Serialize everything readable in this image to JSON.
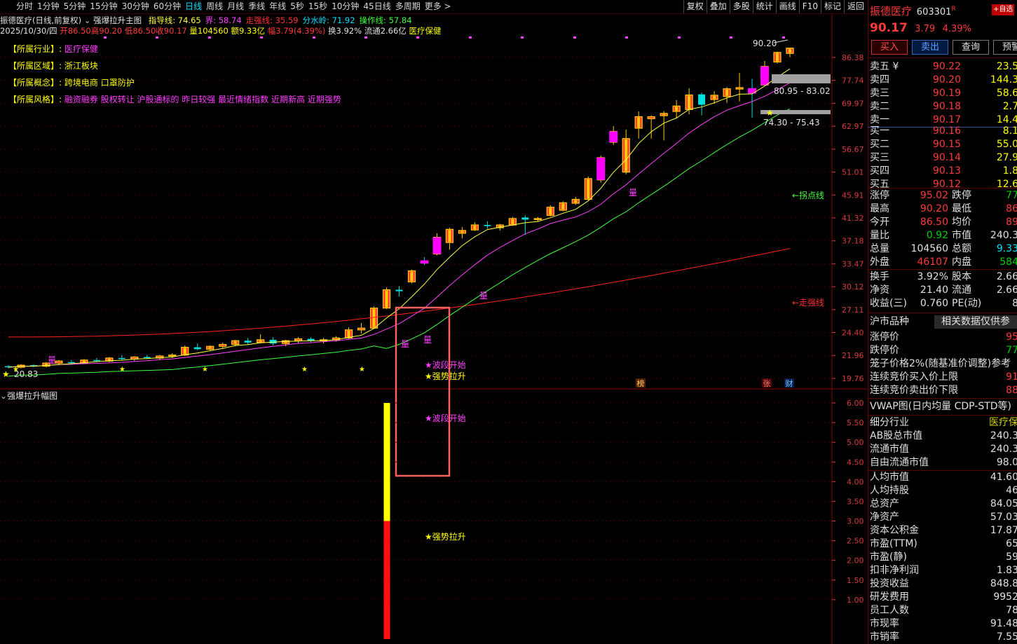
{
  "toolbar": {
    "periods": [
      "分时",
      "1分钟",
      "5分钟",
      "15分钟",
      "30分钟",
      "60分钟",
      "日线",
      "周线",
      "月线",
      "季线",
      "年线",
      "5秒",
      "15秒",
      "10分钟",
      "45日线",
      "多周期",
      "更多 >"
    ],
    "active_period": "日线",
    "right_buttons": [
      "复权",
      "叠加",
      "多股",
      "统计",
      "画线",
      "F10",
      "标记",
      "返回"
    ]
  },
  "indicator_line": {
    "stock": "振德医疗(日线,前复权)",
    "indicator_name": "强爆拉升主图",
    "items": [
      {
        "label": "指导线: 74.65",
        "color": "#ffff40"
      },
      {
        "label": "界: 58.74",
        "color": "#ff40ff"
      },
      {
        "label": "走强线: 35.59",
        "color": "#ff3030"
      },
      {
        "label": "分水岭: 71.92",
        "color": "#00e0ff"
      },
      {
        "label": "操作线: 57.84",
        "color": "#40ff40"
      }
    ]
  },
  "quote_line": {
    "date": "2025/10/30/四",
    "open": "开86.50",
    "high": "高90.20",
    "low": "低86.50",
    "close": "收90.17",
    "volume": "量104560",
    "amount": "额9.33亿",
    "range": "幅3.79(4.39%)",
    "turnover": "换3.92%",
    "float_cap": "流通2.66亿",
    "industry": "医疗保健"
  },
  "sector_info": [
    {
      "key": "【所属行业】:",
      "value": "医疗保健",
      "color": "#ff3cff"
    },
    {
      "key": "【所属区域】:",
      "value": "浙江板块",
      "color": "#ffff00"
    },
    {
      "key": "【所属概念】:",
      "value": "跨境电商 口罩防护",
      "color": "#ffff00"
    },
    {
      "key": "【所属风格】:",
      "value": "融资融券 股权转让 沪股通标的 昨日较强 最近情绪指数 近期新高 近期强势",
      "color": "#ff3cff"
    }
  ],
  "price_axis": [
    "86.38",
    "77.74",
    "69.97",
    "62.97",
    "56.67",
    "51.01",
    "45.91",
    "41.32",
    "37.18",
    "33.47",
    "30.12",
    "27.11",
    "24.40",
    "21.96",
    "19.76"
  ],
  "sub_axis": [
    "6.00",
    "5.50",
    "5.00",
    "4.50",
    "4.00",
    "3.50",
    "3.00",
    "2.50",
    "2.00",
    "1.50",
    "1.00"
  ],
  "sub_title": "强爆拉升幅图",
  "chart_labels": {
    "high_marker": "90.20",
    "zone_upper": "80.95 - 83.02",
    "zone_lower": "74.30 - 75.43",
    "low_marker": "20.83",
    "turn_line": "←拐点线",
    "strong_line": "←走强线",
    "wave_start": "★波段开始",
    "strong_pull": "★强势拉升",
    "vol_mark": "量",
    "bang_tag": "榜",
    "zhang_tag": "张",
    "cai_tag": "财",
    "sub_wave_start": "★波段开始",
    "sub_strong_pull": "★强势拉升"
  },
  "sub_bar": {
    "yellow_top": 6.0,
    "yellow_bottom": 3.0,
    "red_bottom": 0.0
  },
  "chart_data": {
    "type": "candlestick",
    "ohlc": [
      [
        20.9,
        21.0,
        20.7,
        20.8
      ],
      [
        20.8,
        21.1,
        20.7,
        21.0
      ],
      [
        21.0,
        21.1,
        20.8,
        20.9
      ],
      [
        20.9,
        21.3,
        20.8,
        21.2
      ],
      [
        21.2,
        21.5,
        21.0,
        21.4
      ],
      [
        21.3,
        21.5,
        21.1,
        21.2
      ],
      [
        21.2,
        21.6,
        21.1,
        21.5
      ],
      [
        21.5,
        21.7,
        21.3,
        21.4
      ],
      [
        21.4,
        21.8,
        21.3,
        21.7
      ],
      [
        21.7,
        22.0,
        21.5,
        21.6
      ],
      [
        21.6,
        21.9,
        21.4,
        21.8
      ],
      [
        21.8,
        22.0,
        21.6,
        21.7
      ],
      [
        21.7,
        22.0,
        21.5,
        21.9
      ],
      [
        21.9,
        22.2,
        21.7,
        22.0
      ],
      [
        22.0,
        23.0,
        21.9,
        22.8
      ],
      [
        22.8,
        23.2,
        22.5,
        22.6
      ],
      [
        22.6,
        23.0,
        22.4,
        22.9
      ],
      [
        22.9,
        23.3,
        22.7,
        23.1
      ],
      [
        23.1,
        23.6,
        22.9,
        23.5
      ],
      [
        23.5,
        23.8,
        23.1,
        23.3
      ],
      [
        23.3,
        24.2,
        23.2,
        23.6
      ],
      [
        23.6,
        23.9,
        23.0,
        23.2
      ],
      [
        23.2,
        23.6,
        22.9,
        23.5
      ],
      [
        23.5,
        23.9,
        23.2,
        23.7
      ],
      [
        23.7,
        23.9,
        23.3,
        23.5
      ],
      [
        23.5,
        23.8,
        23.2,
        23.6
      ],
      [
        23.6,
        24.0,
        23.4,
        23.8
      ],
      [
        23.8,
        25.0,
        23.7,
        24.7
      ],
      [
        24.7,
        25.5,
        24.3,
        24.9
      ],
      [
        24.9,
        27.5,
        24.8,
        27.3
      ],
      [
        27.3,
        30.0,
        27.2,
        29.7
      ],
      [
        29.7,
        30.2,
        28.8,
        29.5
      ],
      [
        30.8,
        32.6,
        30.6,
        32.4
      ],
      [
        34.0,
        34.5,
        33.3,
        33.5
      ],
      [
        35.0,
        38.5,
        34.8,
        37.8
      ],
      [
        36.9,
        39.5,
        35.7,
        39.2
      ],
      [
        38.5,
        39.6,
        37.6,
        39.0
      ],
      [
        39.1,
        40.5,
        38.9,
        40.0
      ],
      [
        40.0,
        40.7,
        39.3,
        39.8
      ],
      [
        39.5,
        40.2,
        39.0,
        40.0
      ],
      [
        40.0,
        41.5,
        39.8,
        41.2
      ],
      [
        41.4,
        41.8,
        38.2,
        41.0
      ],
      [
        41.1,
        41.5,
        40.6,
        41.2
      ],
      [
        41.8,
        43.8,
        41.6,
        43.4
      ],
      [
        42.8,
        44.6,
        42.6,
        44.3
      ],
      [
        44.2,
        45.5,
        43.9,
        45.0
      ],
      [
        45.0,
        50.0,
        44.8,
        49.5
      ],
      [
        49.2,
        55.0,
        48.6,
        54.5
      ],
      [
        58.5,
        63.0,
        57.8,
        61.5
      ],
      [
        51.0,
        62.0,
        50.5,
        59.5
      ],
      [
        62.4,
        67.4,
        59.5,
        65.8
      ],
      [
        65.2,
        66.2,
        59.5,
        65.8
      ],
      [
        66.1,
        67.5,
        59.0,
        66.8
      ],
      [
        67.4,
        71.0,
        65.2,
        69.1
      ],
      [
        68.0,
        75.0,
        66.5,
        72.7
      ],
      [
        72.9,
        73.5,
        66.2,
        69.5
      ],
      [
        71.2,
        74.0,
        69.8,
        72.6
      ],
      [
        72.2,
        75.4,
        70.1,
        74.8
      ],
      [
        74.7,
        80.5,
        70.6,
        75.2
      ],
      [
        75.0,
        78.3,
        65.5,
        73.2
      ],
      [
        76.1,
        85.0,
        76.0,
        82.9
      ],
      [
        84.6,
        88.8,
        84.0,
        88.4
      ],
      [
        88.0,
        90.2,
        86.5,
        90.17
      ]
    ],
    "series": [
      {
        "name": "指导线",
        "color": "#ffff40"
      },
      {
        "name": "界",
        "color": "#ff40ff"
      },
      {
        "name": "走强线",
        "color": "#ff3030"
      },
      {
        "name": "操作线",
        "color": "#40ff40"
      }
    ]
  },
  "right_panel": {
    "stock_name": "振德医疗",
    "stock_code": "603301",
    "r_tag": "R",
    "fav_button": "+自选",
    "price": "90.17",
    "change": "3.79",
    "change_pct": "4.39%",
    "buttons": [
      "买入",
      "卖出",
      "查询",
      "预警"
    ],
    "asks": [
      {
        "label": "卖五 ¥",
        "price": "90.22",
        "vol": "23.5"
      },
      {
        "label": "卖四",
        "price": "90.20",
        "vol": "144.3"
      },
      {
        "label": "卖三",
        "price": "90.19",
        "vol": "58.6"
      },
      {
        "label": "卖二",
        "price": "90.18",
        "vol": "2.7"
      },
      {
        "label": "卖一",
        "price": "90.17",
        "vol": "14.4"
      }
    ],
    "bids": [
      {
        "label": "买一",
        "price": "90.16",
        "vol": "8.1"
      },
      {
        "label": "买二",
        "price": "90.15",
        "vol": "55.0"
      },
      {
        "label": "买三",
        "price": "90.14",
        "vol": "27.9"
      },
      {
        "label": "买四",
        "price": "90.13",
        "vol": "1.8"
      },
      {
        "label": "买五",
        "price": "90.12",
        "vol": "12.6"
      }
    ],
    "stats": [
      {
        "l1": "涨停",
        "v1": "95.02",
        "c1": "#ff3a3a",
        "l2": "跌停",
        "v2": "77",
        "c2": "#00d000"
      },
      {
        "l1": "最高",
        "v1": "90.20",
        "c1": "#ff3a3a",
        "l2": "最低",
        "v2": "86",
        "c2": "#ff3a3a"
      },
      {
        "l1": "今开",
        "v1": "86.50",
        "c1": "#ff3a3a",
        "l2": "均价",
        "v2": "89",
        "c2": "#ff3a3a"
      },
      {
        "l1": "量比",
        "v1": "0.92",
        "c1": "#00d000",
        "l2": "市值",
        "v2": "240.3",
        "c2": "#e0e0e0"
      },
      {
        "l1": "总量",
        "v1": "104560",
        "c1": "#e0e0e0",
        "l2": "总额",
        "v2": "9.33",
        "c2": "#00e0ff"
      },
      {
        "l1": "外盘",
        "v1": "46107",
        "c1": "#ff3a3a",
        "l2": "内盘",
        "v2": "584",
        "c2": "#00d000"
      }
    ],
    "stats2": [
      {
        "l1": "换手",
        "v1": "3.92%",
        "c1": "#e0e0e0",
        "l2": "股本",
        "v2": "2.66",
        "c2": "#e0e0e0"
      },
      {
        "l1": "净资",
        "v1": "21.40",
        "c1": "#e0e0e0",
        "l2": "流通",
        "v2": "2.66",
        "c2": "#e0e0e0"
      },
      {
        "l1": "收益(三)",
        "v1": "0.760",
        "c1": "#e0e0e0",
        "l2": "PE(动)",
        "v2": "8",
        "c2": "#e0e0e0"
      }
    ],
    "tab_a": "沪市品种",
    "tab_b": "相关数据仅供参",
    "limit_rows": [
      {
        "label": "涨停价",
        "value": "95",
        "color": "#ff3a3a"
      },
      {
        "label": "跌停价",
        "value": "77",
        "color": "#00d000"
      },
      {
        "label": "笼子价格2%(随基准价调整)参考",
        "value": "",
        "color": "#e0e0e0"
      },
      {
        "label": "连续竞价买入价上限",
        "value": "91",
        "color": "#ff3a3a"
      },
      {
        "label": "连续竞价卖出价下限",
        "value": "88",
        "color": "#ff3a3a"
      }
    ],
    "vwap_title": "VWAP图(日内均量 CDP-STD等)",
    "fund_rows": [
      {
        "label": "细分行业",
        "value": "医疗保",
        "color": "#d0d000"
      },
      {
        "label": "AB股总市值",
        "value": "240.3",
        "color": "#e0e0e0"
      },
      {
        "label": "流通市值",
        "value": "240.3",
        "color": "#e0e0e0"
      },
      {
        "label": "自由流通市值",
        "value": "98.0",
        "color": "#e0e0e0"
      },
      {
        "label": "人均市值",
        "value": "41.60",
        "color": "#e0e0e0"
      },
      {
        "label": "人均持股",
        "value": "46",
        "color": "#e0e0e0"
      },
      {
        "label": "总资产",
        "value": "84.05",
        "color": "#e0e0e0"
      },
      {
        "label": "净资产",
        "value": "57.03",
        "color": "#e0e0e0"
      },
      {
        "label": "资本公积金",
        "value": "17.87",
        "color": "#e0e0e0"
      },
      {
        "label": "市盈(TTM)",
        "value": "65",
        "color": "#e0e0e0"
      },
      {
        "label": "市盈(静)",
        "value": "59",
        "color": "#e0e0e0"
      },
      {
        "label": "扣非净利润",
        "value": "1.83",
        "color": "#e0e0e0"
      },
      {
        "label": "投资收益",
        "value": "848.8",
        "color": "#e0e0e0"
      },
      {
        "label": "研发费用",
        "value": "9952",
        "color": "#e0e0e0"
      },
      {
        "label": "员工人数",
        "value": "78",
        "color": "#e0e0e0"
      },
      {
        "label": "市现率",
        "value": "91.48",
        "color": "#e0e0e0"
      },
      {
        "label": "市销率",
        "value": "7.55",
        "color": "#e0e0e0"
      }
    ]
  }
}
